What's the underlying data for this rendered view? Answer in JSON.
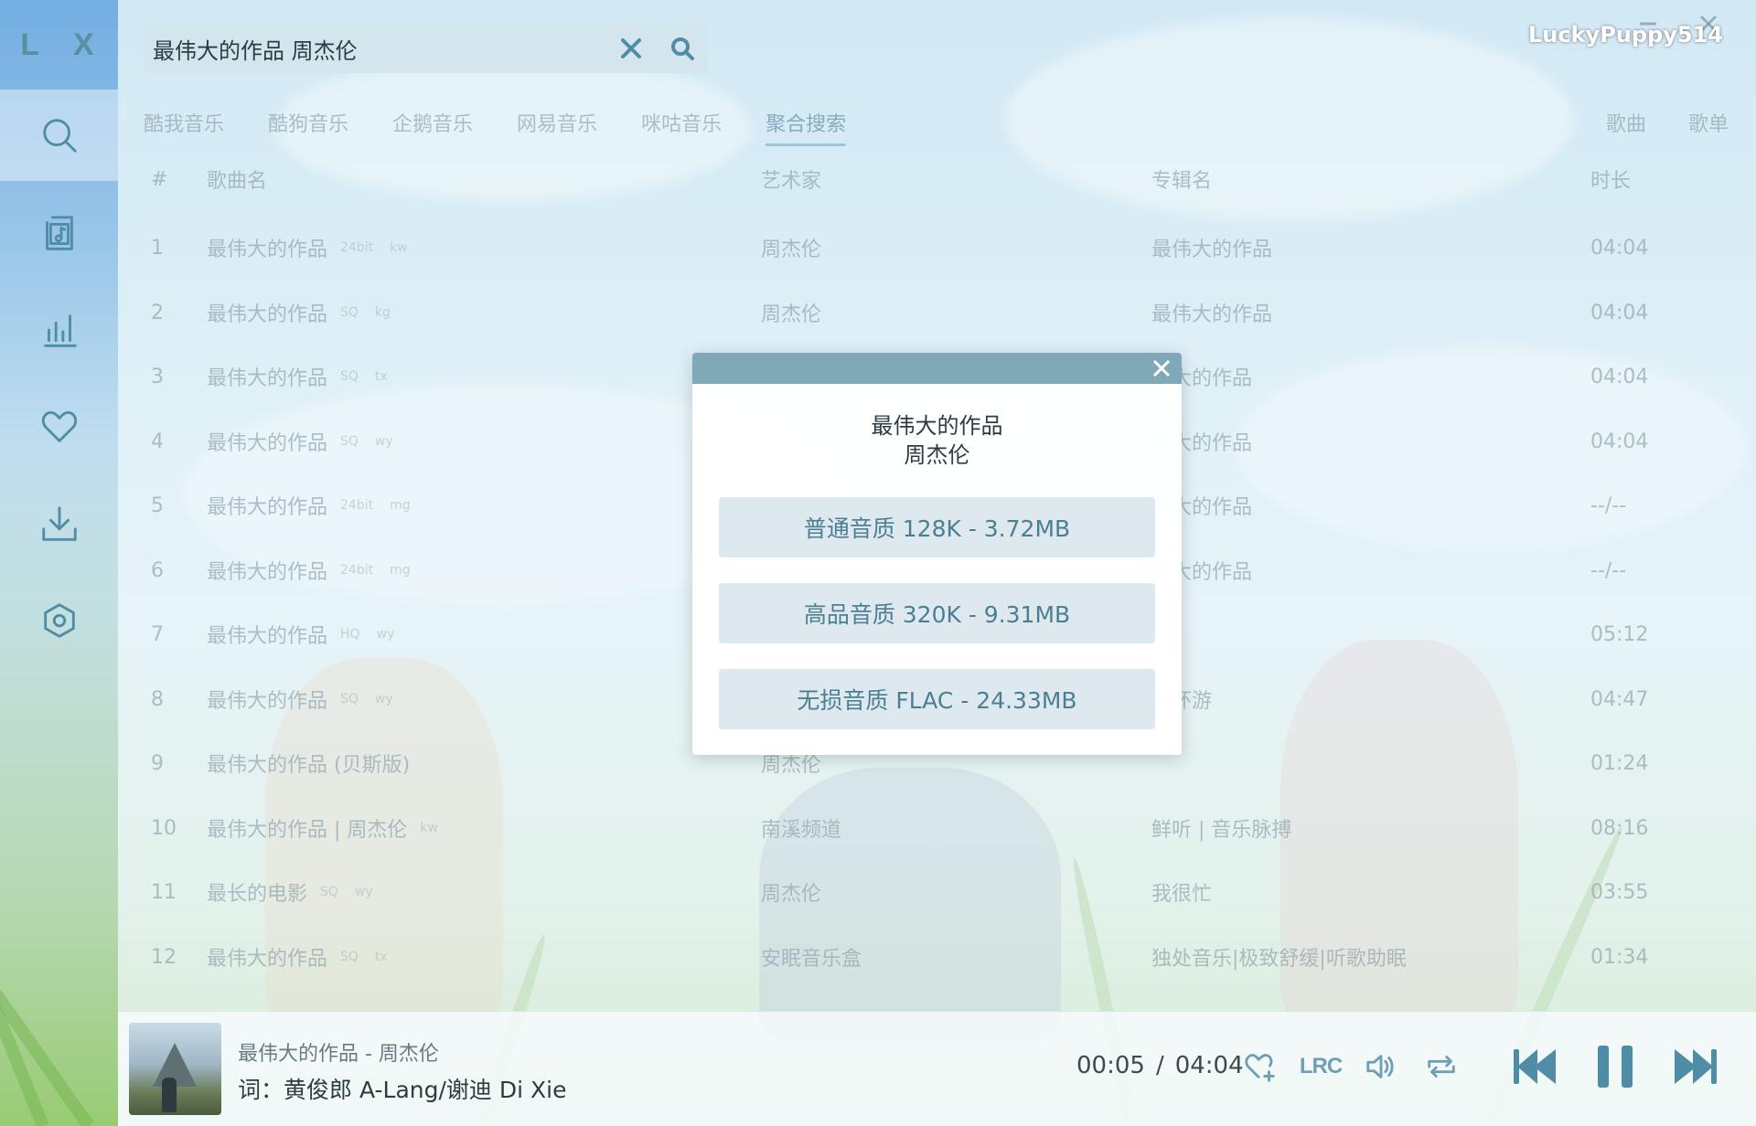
{
  "app": {
    "logo": "L X"
  },
  "user": {
    "name": "LuckyPuppy514"
  },
  "search": {
    "query": "最伟大的作品 周杰伦",
    "placeholder": ""
  },
  "source_tabs": [
    {
      "label": "酷我音乐"
    },
    {
      "label": "酷狗音乐"
    },
    {
      "label": "企鹅音乐"
    },
    {
      "label": "网易音乐"
    },
    {
      "label": "咪咕音乐"
    },
    {
      "label": "聚合搜索",
      "active": true
    }
  ],
  "type_tabs": [
    {
      "label": "歌曲",
      "active": true
    },
    {
      "label": "歌单"
    }
  ],
  "table": {
    "headers": {
      "idx": "#",
      "name": "歌曲名",
      "artist": "艺术家",
      "album": "专辑名",
      "duration": "时长"
    },
    "rows": [
      {
        "idx": "1",
        "name": "最伟大的作品",
        "quality": "24bit",
        "src": "kw",
        "artist": "周杰伦",
        "album": "最伟大的作品",
        "duration": "04:04"
      },
      {
        "idx": "2",
        "name": "最伟大的作品",
        "quality": "SQ",
        "src": "kg",
        "artist": "周杰伦",
        "album": "最伟大的作品",
        "duration": "04:04"
      },
      {
        "idx": "3",
        "name": "最伟大的作品",
        "quality": "SQ",
        "src": "tx",
        "artist": "",
        "album": "伟大的作品",
        "duration": "04:04"
      },
      {
        "idx": "4",
        "name": "最伟大的作品",
        "quality": "SQ",
        "src": "wy",
        "artist": "",
        "album": "伟大的作品",
        "duration": "04:04"
      },
      {
        "idx": "5",
        "name": "最伟大的作品",
        "quality": "24bit",
        "src": "mg",
        "artist": "",
        "album": "伟大的作品",
        "duration": "--/--"
      },
      {
        "idx": "6",
        "name": "最伟大的作品",
        "quality": "24bit",
        "src": "mg",
        "artist": "",
        "album": "伟大的作品",
        "duration": "--/--"
      },
      {
        "idx": "7",
        "name": "最伟大的作品",
        "quality": "HQ",
        "src": "wy",
        "artist": "",
        "album": "",
        "duration": "05:12"
      },
      {
        "idx": "8",
        "name": "最伟大的作品",
        "quality": "SQ",
        "src": "wy",
        "artist": "",
        "album": "风环游",
        "duration": "04:47"
      },
      {
        "idx": "9",
        "name": "最伟大的作品 (贝斯版)",
        "quality": "",
        "src": "",
        "artist": "周杰伦",
        "album": "",
        "duration": "01:24"
      },
      {
        "idx": "10",
        "name": "最伟大的作品 | 周杰伦",
        "quality": "",
        "src": "kw",
        "artist": "南溪频道",
        "album": "鲜听 | 音乐脉搏",
        "duration": "08:16"
      },
      {
        "idx": "11",
        "name": "最长的电影",
        "quality": "SQ",
        "src": "wy",
        "artist": "周杰伦",
        "album": "我很忙",
        "duration": "03:55"
      },
      {
        "idx": "12",
        "name": "最伟大的作品",
        "quality": "SQ",
        "src": "tx",
        "artist": "安眠音乐盒",
        "album": "独处音乐|极致舒缓|听歌助眠",
        "duration": "01:34"
      }
    ]
  },
  "modal": {
    "title": "最伟大的作品",
    "artist": "周杰伦",
    "options": [
      {
        "label": "普通音质 128K - 3.72MB"
      },
      {
        "label": "高品音质 320K - 9.31MB"
      },
      {
        "label": "无损音质 FLAC - 24.33MB"
      }
    ]
  },
  "player": {
    "track": "最伟大的作品 - 周杰伦",
    "lyric": "词：黄俊郎 A-Lang/谢迪 Di Xie",
    "current_time": "00:05",
    "separator": "/",
    "total_time": "04:04",
    "progress": 0.02,
    "lrc_label": "LRC"
  },
  "icons": {
    "nav": [
      "search-icon",
      "music-file-icon",
      "chart-icon",
      "heart-icon",
      "download-icon",
      "settings-icon"
    ],
    "player": [
      "heart-add-icon",
      "lrc-icon",
      "volume-icon",
      "repeat-icon",
      "previous-icon",
      "pause-icon",
      "next-icon"
    ]
  },
  "colors": {
    "accent": "#4f8da6",
    "modal_bar": "#7fa9b8",
    "button_bg": "#dde9ee"
  }
}
